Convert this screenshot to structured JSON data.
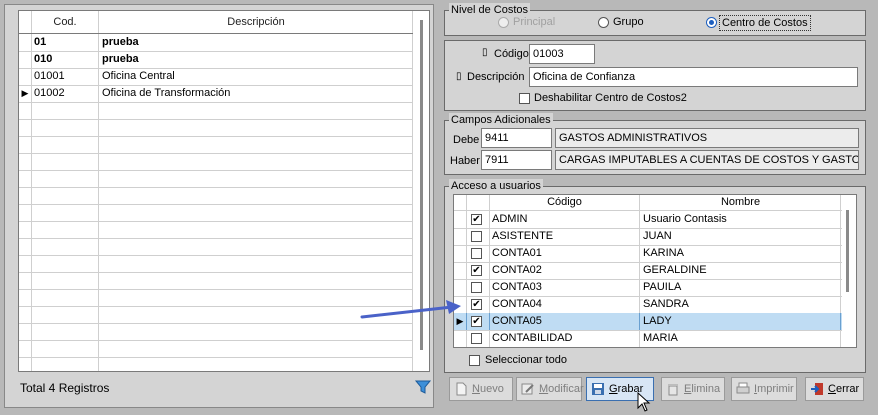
{
  "left_grid": {
    "headers": {
      "code": "Cod.",
      "description": "Descripción"
    },
    "rows": [
      {
        "code": "01",
        "description": "prueba",
        "bold": true,
        "current": false
      },
      {
        "code": "010",
        "description": "prueba",
        "bold": true,
        "current": false
      },
      {
        "code": "01001",
        "description": "Oficina Central",
        "bold": false,
        "current": false
      },
      {
        "code": "01002",
        "description": "Oficina de Transformación",
        "bold": false,
        "current": true
      }
    ],
    "current_marker": "▶"
  },
  "footer": {
    "total": "Total 4 Registros",
    "filter_icon": "funnel-icon"
  },
  "nivel": {
    "title": "Nivel de Costos",
    "options": [
      {
        "label": "Principal",
        "disabled": true,
        "checked": false
      },
      {
        "label": "Grupo",
        "disabled": false,
        "checked": false
      },
      {
        "label": "Centro de Costos",
        "disabled": false,
        "checked": true
      }
    ]
  },
  "detail": {
    "codigo_label": "Código",
    "codigo_value": "01003",
    "descripcion_label": "Descripción",
    "descripcion_value": "Oficina de Confianza",
    "deshabilitar_label": "Deshabilitar Centro de Costos2",
    "deshabilitar_checked": false
  },
  "campos": {
    "title": "Campos Adicionales",
    "debe_label": "Debe",
    "debe_code": "9411",
    "debe_desc": "GASTOS ADMINISTRATIVOS",
    "haber_label": "Haber",
    "haber_code": "7911",
    "haber_desc": "CARGAS IMPUTABLES A CUENTAS DE COSTOS Y GASTOS"
  },
  "acceso": {
    "title": "Acceso a usuarios",
    "headers": {
      "code": "Código",
      "name": "Nombre"
    },
    "rows": [
      {
        "code": "ADMIN",
        "name": "Usuario Contasis",
        "checked": true,
        "selected": false
      },
      {
        "code": "ASISTENTE",
        "name": "JUAN",
        "checked": false,
        "selected": false
      },
      {
        "code": "CONTA01",
        "name": "KARINA",
        "checked": false,
        "selected": false
      },
      {
        "code": "CONTA02",
        "name": "GERALDINE",
        "checked": true,
        "selected": false
      },
      {
        "code": "CONTA03",
        "name": "PAUILA",
        "checked": false,
        "selected": false
      },
      {
        "code": "CONTA04",
        "name": "SANDRA",
        "checked": true,
        "selected": false
      },
      {
        "code": "CONTA05",
        "name": "LADY",
        "checked": true,
        "selected": true
      },
      {
        "code": "CONTABILIDAD",
        "name": "MARIA",
        "checked": false,
        "selected": false
      }
    ],
    "select_all_label": "Seleccionar todo"
  },
  "toolbar": {
    "nuevo": {
      "u": "N",
      "rest": "uevo"
    },
    "modificar": {
      "u": "M",
      "rest": "odificar"
    },
    "grabar": {
      "u": "G",
      "rest": "rabar"
    },
    "elimina": {
      "u": "E",
      "rest": "limina"
    },
    "imprimir": {
      "u": "I",
      "rest": "mprimir"
    },
    "cerrar": {
      "u": "C",
      "rest": "errar"
    }
  },
  "colors": {
    "accent": "#1d5fbf",
    "selection": "#bfdcf3",
    "arrow": "#4a62c8"
  }
}
